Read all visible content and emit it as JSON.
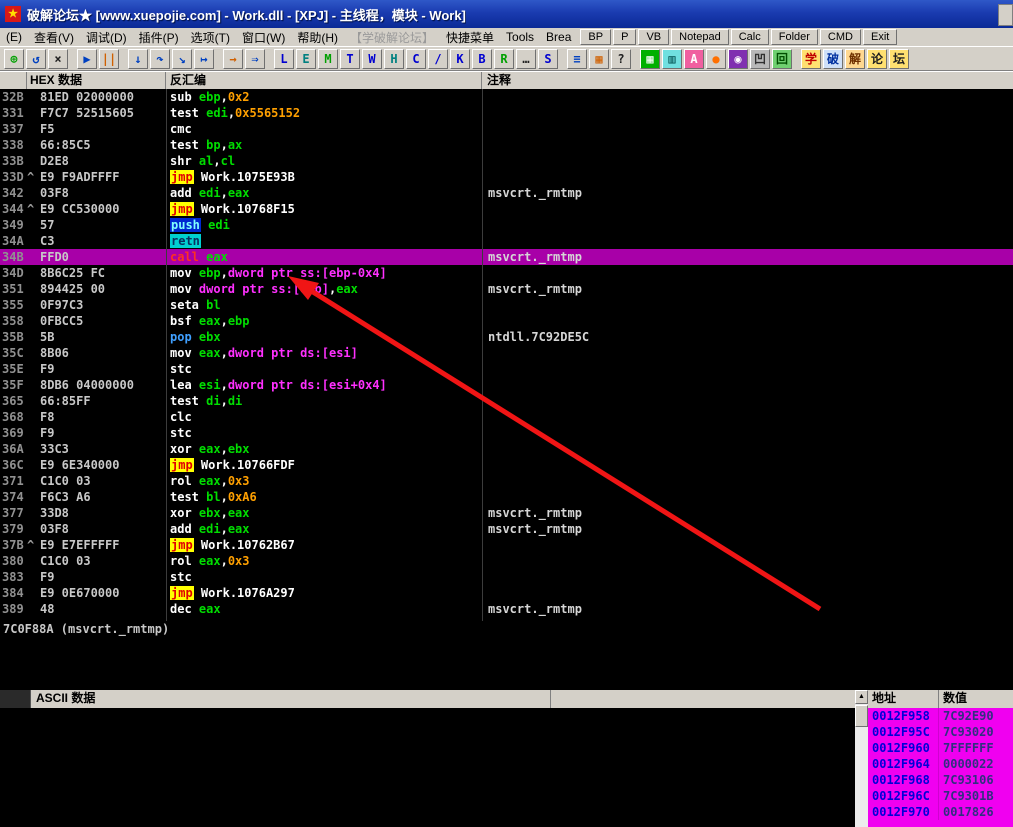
{
  "window": {
    "title": "破解论坛★ [www.xuepojie.com]  -  Work.dll - [XPJ] -  主线程，模块 - Work]",
    "icon_glyph": "★"
  },
  "menu": {
    "items": [
      {
        "label": "(E)"
      },
      {
        "label": "查看(V)"
      },
      {
        "label": "调试(D)"
      },
      {
        "label": "插件(P)"
      },
      {
        "label": "选项(T)"
      },
      {
        "label": "窗口(W)"
      },
      {
        "label": "帮助(H)"
      },
      {
        "label": "【学破解论坛】",
        "muted": true
      },
      {
        "label": "快捷菜单"
      },
      {
        "label": "Tools"
      },
      {
        "label": "Brea"
      }
    ],
    "buttons": [
      "BP",
      "P",
      "VB",
      "Notepad",
      "Calc",
      "Folder",
      "CMD",
      "Exit"
    ]
  },
  "toolbar": {
    "buttons": [
      {
        "n": "open-icon",
        "g": "⊕",
        "c": "#00a000"
      },
      {
        "n": "restart-icon",
        "g": "↺",
        "c": "#0040c0"
      },
      {
        "n": "close-icon",
        "g": "×",
        "c": "#202020"
      },
      {
        "n": "run-icon",
        "g": "▶",
        "c": "#0040c0",
        "gap": true
      },
      {
        "n": "pause-icon",
        "g": "||",
        "c": "#d06000"
      },
      {
        "n": "step-into-icon",
        "g": "↓",
        "c": "#0040c0",
        "gap": true
      },
      {
        "n": "step-over-icon",
        "g": "↷",
        "c": "#0040c0"
      },
      {
        "n": "trace-into-icon",
        "g": "↘",
        "c": "#0040c0"
      },
      {
        "n": "trace-over-icon",
        "g": "↦",
        "c": "#0040c0"
      },
      {
        "n": "until-return-icon",
        "g": "→",
        "c": "#d06000",
        "gap": true
      },
      {
        "n": "goto-icon",
        "g": "⇒",
        "c": "#0040c0"
      },
      {
        "n": "log-button",
        "g": "L",
        "c": "#0000d0",
        "gap": true
      },
      {
        "n": "executables-button",
        "g": "E",
        "c": "#008080"
      },
      {
        "n": "memory-button",
        "g": "M",
        "c": "#00a000"
      },
      {
        "n": "threads-button",
        "g": "T",
        "c": "#0000d0"
      },
      {
        "n": "windows-button",
        "g": "W",
        "c": "#0000d0"
      },
      {
        "n": "handles-button",
        "g": "H",
        "c": "#008080"
      },
      {
        "n": "cpu-button",
        "g": "C",
        "c": "#0000d0"
      },
      {
        "n": "patches-button",
        "g": "/",
        "c": "#0000d0"
      },
      {
        "n": "callstack-button",
        "g": "K",
        "c": "#0000d0"
      },
      {
        "n": "breakpoints-button",
        "g": "B",
        "c": "#0000d0"
      },
      {
        "n": "references-button",
        "g": "R",
        "c": "#00a000"
      },
      {
        "n": "runtrace-button",
        "g": "…",
        "c": "#202020"
      },
      {
        "n": "source-button",
        "g": "S",
        "c": "#0000d0"
      },
      {
        "n": "options-icon",
        "g": "≡",
        "c": "#0040c0",
        "gap": true
      },
      {
        "n": "appearance-icon",
        "g": "▦",
        "c": "#d06000"
      },
      {
        "n": "help-icon",
        "g": "?",
        "c": "#202020"
      },
      {
        "n": "plugin-green-grid-icon",
        "g": "▦",
        "c": "#ffffff",
        "b": "#00b000",
        "gap": true
      },
      {
        "n": "plugin-cyan-icon",
        "g": "▥",
        "c": "#005050",
        "b": "#70e0e0"
      },
      {
        "n": "plugin-pink-a-icon",
        "g": "A",
        "c": "#ffffff",
        "b": "#f060a0"
      },
      {
        "n": "plugin-orange-dot-icon",
        "g": "●",
        "c": "#ff7000"
      },
      {
        "n": "plugin-purple-icon",
        "g": "◉",
        "c": "#ffffff",
        "b": "#8030b0"
      },
      {
        "n": "plugin-gray-icon",
        "g": "凹",
        "c": "#303030",
        "b": "#b8b8b8"
      },
      {
        "n": "plugin-screen-icon",
        "g": "回",
        "c": "#005000",
        "b": "#70d070"
      },
      {
        "n": "xue-button",
        "g": "学",
        "c": "#c00000",
        "b": "#ffe070",
        "gap": true
      },
      {
        "n": "po-button",
        "g": "破",
        "c": "#0030a0",
        "b": "#cfe0f8"
      },
      {
        "n": "jie-button",
        "g": "解",
        "c": "#703000",
        "b": "#ffd890"
      },
      {
        "n": "lun-button",
        "g": "论",
        "c": "#202020",
        "b": "#ffe070"
      },
      {
        "n": "tan-button",
        "g": "坛",
        "c": "#202020",
        "b": "#ffe070"
      }
    ]
  },
  "disasm": {
    "headers": [
      "HEX 数据",
      "反汇编",
      "注释"
    ],
    "rows": [
      {
        "a": "32B",
        "h": "81ED 02000000",
        "t": [
          [
            "m",
            "sub "
          ],
          [
            "r",
            "ebp"
          ],
          [
            "p",
            ","
          ],
          [
            "n",
            "0x2"
          ]
        ]
      },
      {
        "a": "331",
        "h": "F7C7 52515605",
        "t": [
          [
            "m",
            "test "
          ],
          [
            "r",
            "edi"
          ],
          [
            "p",
            ","
          ],
          [
            "n",
            "0x5565152"
          ]
        ]
      },
      {
        "a": "337",
        "h": "F5",
        "t": [
          [
            "m",
            "cmc"
          ]
        ]
      },
      {
        "a": "338",
        "h": "66:85C5",
        "t": [
          [
            "m",
            "test "
          ],
          [
            "r",
            "bp"
          ],
          [
            "p",
            ","
          ],
          [
            "r",
            "ax"
          ]
        ]
      },
      {
        "a": "33B",
        "h": "D2E8",
        "t": [
          [
            "m",
            "shr "
          ],
          [
            "r",
            "al"
          ],
          [
            "p",
            ","
          ],
          [
            "r",
            "cl"
          ]
        ]
      },
      {
        "a": "33D",
        "k": "^",
        "h": "E9 F9ADFFFF",
        "t": [
          [
            "mj",
            "jmp"
          ],
          [
            "sp",
            " "
          ],
          [
            "t",
            "Work.1075E93B"
          ]
        ]
      },
      {
        "a": "342",
        "h": "03F8",
        "t": [
          [
            "m",
            "add "
          ],
          [
            "r",
            "edi"
          ],
          [
            "p",
            ","
          ],
          [
            "r",
            "eax"
          ]
        ],
        "c": "msvcrt._rmtmp"
      },
      {
        "a": "344",
        "k": "^",
        "h": "E9 CC530000",
        "t": [
          [
            "mj",
            "jmp"
          ],
          [
            "sp",
            " "
          ],
          [
            "t",
            "Work.10768F15"
          ]
        ]
      },
      {
        "a": "349",
        "h": "57",
        "t": [
          [
            "mp",
            "push"
          ],
          [
            "sp",
            " "
          ],
          [
            "r",
            "edi"
          ]
        ]
      },
      {
        "a": "34A",
        "h": "C3",
        "t": [
          [
            "mr",
            "retn"
          ]
        ]
      },
      {
        "a": "34B",
        "h": "FFD0",
        "t": [
          [
            "mc",
            "call"
          ],
          [
            "sp",
            " "
          ],
          [
            "r",
            "eax"
          ]
        ],
        "c": "msvcrt._rmtmp",
        "sel": true
      },
      {
        "a": "34D",
        "h": "8B6C25 FC",
        "t": [
          [
            "m",
            "mov "
          ],
          [
            "r",
            "ebp"
          ],
          [
            "p",
            ","
          ],
          [
            "mem",
            "dword ptr ss:[ebp-0x4]"
          ]
        ]
      },
      {
        "a": "351",
        "h": "894425 00",
        "t": [
          [
            "m",
            "mov "
          ],
          [
            "mem",
            "dword ptr ss:[ebp]"
          ],
          [
            "p",
            ","
          ],
          [
            "r",
            "eax"
          ]
        ],
        "c": "msvcrt._rmtmp"
      },
      {
        "a": "355",
        "h": "0F97C3",
        "t": [
          [
            "m",
            "seta "
          ],
          [
            "r",
            "bl"
          ]
        ]
      },
      {
        "a": "358",
        "h": "0FBCC5",
        "t": [
          [
            "m",
            "bsf "
          ],
          [
            "r",
            "eax"
          ],
          [
            "p",
            ","
          ],
          [
            "r",
            "ebp"
          ]
        ]
      },
      {
        "a": "35B",
        "h": "5B",
        "t": [
          [
            "mb",
            "pop"
          ],
          [
            "sp",
            " "
          ],
          [
            "r",
            "ebx"
          ]
        ],
        "c": "ntdll.7C92DE5C"
      },
      {
        "a": "35C",
        "h": "8B06",
        "t": [
          [
            "m",
            "mov "
          ],
          [
            "r",
            "eax"
          ],
          [
            "p",
            ","
          ],
          [
            "mem",
            "dword ptr ds:[esi]"
          ]
        ]
      },
      {
        "a": "35E",
        "h": "F9",
        "t": [
          [
            "m",
            "stc"
          ]
        ]
      },
      {
        "a": "35F",
        "h": "8DB6 04000000",
        "t": [
          [
            "m",
            "lea "
          ],
          [
            "r",
            "esi"
          ],
          [
            "p",
            ","
          ],
          [
            "mem",
            "dword ptr ds:[esi+0x4]"
          ]
        ]
      },
      {
        "a": "365",
        "h": "66:85FF",
        "t": [
          [
            "m",
            "test "
          ],
          [
            "r",
            "di"
          ],
          [
            "p",
            ","
          ],
          [
            "r",
            "di"
          ]
        ]
      },
      {
        "a": "368",
        "h": "F8",
        "t": [
          [
            "m",
            "clc"
          ]
        ]
      },
      {
        "a": "369",
        "h": "F9",
        "t": [
          [
            "m",
            "stc"
          ]
        ]
      },
      {
        "a": "36A",
        "h": "33C3",
        "t": [
          [
            "m",
            "xor "
          ],
          [
            "r",
            "eax"
          ],
          [
            "p",
            ","
          ],
          [
            "r",
            "ebx"
          ]
        ]
      },
      {
        "a": "36C",
        "h": "E9 6E340000",
        "t": [
          [
            "mj",
            "jmp"
          ],
          [
            "sp",
            " "
          ],
          [
            "t",
            "Work.10766FDF"
          ]
        ]
      },
      {
        "a": "371",
        "h": "C1C0 03",
        "t": [
          [
            "m",
            "rol "
          ],
          [
            "r",
            "eax"
          ],
          [
            "p",
            ","
          ],
          [
            "n",
            "0x3"
          ]
        ]
      },
      {
        "a": "374",
        "h": "F6C3 A6",
        "t": [
          [
            "m",
            "test "
          ],
          [
            "r",
            "bl"
          ],
          [
            "p",
            ","
          ],
          [
            "n",
            "0xA6"
          ]
        ]
      },
      {
        "a": "377",
        "h": "33D8",
        "t": [
          [
            "m",
            "xor "
          ],
          [
            "r",
            "ebx"
          ],
          [
            "p",
            ","
          ],
          [
            "r",
            "eax"
          ]
        ],
        "c": "msvcrt._rmtmp"
      },
      {
        "a": "379",
        "h": "03F8",
        "t": [
          [
            "m",
            "add "
          ],
          [
            "r",
            "edi"
          ],
          [
            "p",
            ","
          ],
          [
            "r",
            "eax"
          ]
        ],
        "c": "msvcrt._rmtmp"
      },
      {
        "a": "37B",
        "k": "^",
        "h": "E9 E7EFFFFF",
        "t": [
          [
            "mj",
            "jmp"
          ],
          [
            "sp",
            " "
          ],
          [
            "t",
            "Work.10762B67"
          ]
        ]
      },
      {
        "a": "380",
        "h": "C1C0 03",
        "t": [
          [
            "m",
            "rol "
          ],
          [
            "r",
            "eax"
          ],
          [
            "p",
            ","
          ],
          [
            "n",
            "0x3"
          ]
        ]
      },
      {
        "a": "383",
        "h": "F9",
        "t": [
          [
            "m",
            "stc"
          ]
        ]
      },
      {
        "a": "384",
        "h": "E9 0E670000",
        "t": [
          [
            "mj",
            "jmp"
          ],
          [
            "sp",
            " "
          ],
          [
            "t",
            "Work.1076A297"
          ]
        ]
      },
      {
        "a": "389",
        "h": "48",
        "t": [
          [
            "m",
            "dec "
          ],
          [
            "r",
            "eax"
          ]
        ],
        "c": "msvcrt._rmtmp"
      }
    ]
  },
  "info_line": "7C0F88A (msvcrt._rmtmp)",
  "dump": {
    "header": "ASCII 数据"
  },
  "stack": {
    "headers": [
      "地址",
      "数值"
    ],
    "rows": [
      [
        "0012F958",
        "7C92E90"
      ],
      [
        "0012F95C",
        "7C93020"
      ],
      [
        "0012F960",
        "7FFFFFF"
      ],
      [
        "0012F964",
        "0000022"
      ],
      [
        "0012F968",
        "7C93106"
      ],
      [
        "0012F96C",
        "7C9301B"
      ],
      [
        "0012F970",
        "0017826"
      ]
    ]
  },
  "colors": {
    "selection_bg": "#a800a8",
    "stack_row_bg": "#f000f0",
    "jmp_fg": "#e00000",
    "jmp_bg": "#ffff00",
    "register_fg": "#00dd00",
    "immediate_fg": "#ffa000",
    "memory_fg": "#ff30ff",
    "arrow": "#f01515",
    "title_bar": "#1a3bb0"
  }
}
